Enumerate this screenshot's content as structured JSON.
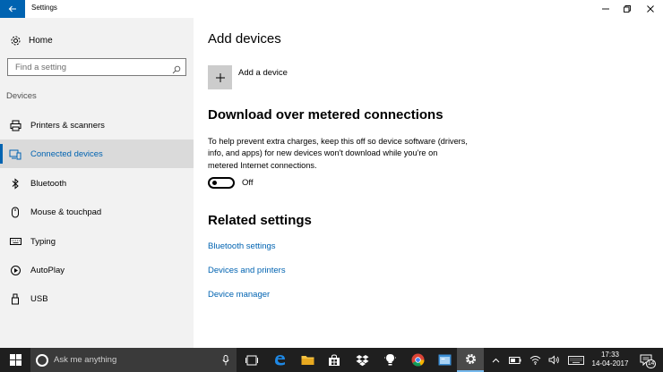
{
  "window": {
    "title": "Settings"
  },
  "sidebar": {
    "home_label": "Home",
    "search_placeholder": "Find a setting",
    "section_label": "Devices",
    "items": [
      {
        "label": "Printers & scanners",
        "icon": "printer-icon"
      },
      {
        "label": "Connected devices",
        "icon": "connected-devices-icon",
        "active": true
      },
      {
        "label": "Bluetooth",
        "icon": "bluetooth-icon"
      },
      {
        "label": "Mouse & touchpad",
        "icon": "mouse-icon"
      },
      {
        "label": "Typing",
        "icon": "keyboard-icon"
      },
      {
        "label": "AutoPlay",
        "icon": "autoplay-icon"
      },
      {
        "label": "USB",
        "icon": "usb-icon"
      }
    ]
  },
  "main": {
    "add_devices_heading": "Add devices",
    "add_device_label": "Add a device",
    "metered_heading": "Download over metered connections",
    "metered_description": "To help prevent extra charges, keep this off so device software (drivers, info, and apps) for new devices won't download while you're on metered Internet connections.",
    "metered_toggle_state": "Off",
    "related_heading": "Related settings",
    "related_links": [
      "Bluetooth settings",
      "Devices and printers",
      "Device manager"
    ]
  },
  "taskbar": {
    "search_text": "Ask me anything",
    "time": "17:33",
    "date": "14-04-2017",
    "notification_count": "14"
  },
  "colors": {
    "accent": "#0063b1",
    "sidebar_bg": "#f2f2f2",
    "taskbar_bg": "#1f1f1f"
  }
}
